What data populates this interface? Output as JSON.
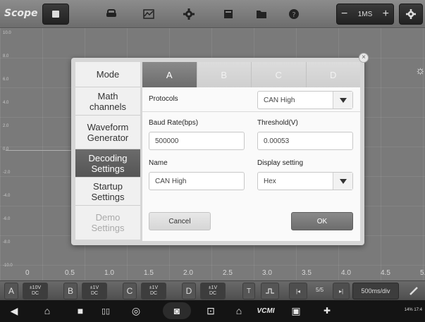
{
  "app": {
    "title": "Scope"
  },
  "toolbar": {
    "icons": [
      "record-icon",
      "car-icon",
      "measure-icon",
      "gear-icon",
      "note-icon",
      "folder-icon",
      "help-icon",
      "settings-icon"
    ],
    "timebase": {
      "minus": "−",
      "value": "1MS",
      "plus": "+"
    }
  },
  "scope": {
    "y_ticks": [
      "10.0",
      "8.0",
      "6.0",
      "4.0",
      "2.0",
      "0.0",
      "-2.0",
      "-4.0",
      "-6.0",
      "-8.0",
      "-10.0"
    ],
    "x_ticks": [
      "0",
      "0.5",
      "1.0",
      "1.5",
      "2.0",
      "2.5",
      "3.0",
      "3.5",
      "4.0",
      "4.5",
      "5.0"
    ]
  },
  "channels": [
    {
      "letter": "A",
      "range": "±10V",
      "coupling": "DC"
    },
    {
      "letter": "B",
      "range": "±1V",
      "coupling": "DC"
    },
    {
      "letter": "C",
      "range": "±1V",
      "coupling": "DC"
    },
    {
      "letter": "D",
      "range": "±1V",
      "coupling": "DC"
    }
  ],
  "chanbar": {
    "trigger": "T",
    "page": "5/5",
    "time_div": "500ms/div"
  },
  "dialog": {
    "menu": [
      {
        "label": "Mode",
        "state": "normal"
      },
      {
        "label": "Math channels",
        "state": "normal"
      },
      {
        "label": "Waveform Generator",
        "state": "normal"
      },
      {
        "label": "Decoding Settings",
        "state": "selected"
      },
      {
        "label": "Startup Settings",
        "state": "normal"
      },
      {
        "label": "Demo Settings",
        "state": "disabled"
      }
    ],
    "tabs": [
      "A",
      "B",
      "C",
      "D"
    ],
    "protocols_label": "Protocols",
    "protocols_value": "CAN High",
    "baud_label": "Baud Rate(bps)",
    "baud_value": "500000",
    "threshold_label": "Threshold(V)",
    "threshold_value": "0.00053",
    "name_label": "Name",
    "name_value": "CAN High",
    "display_label": "Display setting",
    "display_value": "Hex",
    "cancel": "Cancel",
    "ok": "OK"
  },
  "navbar": {
    "icons": [
      "back-icon",
      "home-icon",
      "recent-apps-icon",
      "split-icon",
      "shield-icon",
      "camera-icon",
      "screenshot-icon",
      "house-icon",
      "vcm-icon",
      "car-icon",
      "doctor-icon"
    ],
    "vcm_label": "VCMI",
    "status": "14% 17:4"
  },
  "colors": {
    "selected": "#606060",
    "panel": "#fafafa"
  }
}
